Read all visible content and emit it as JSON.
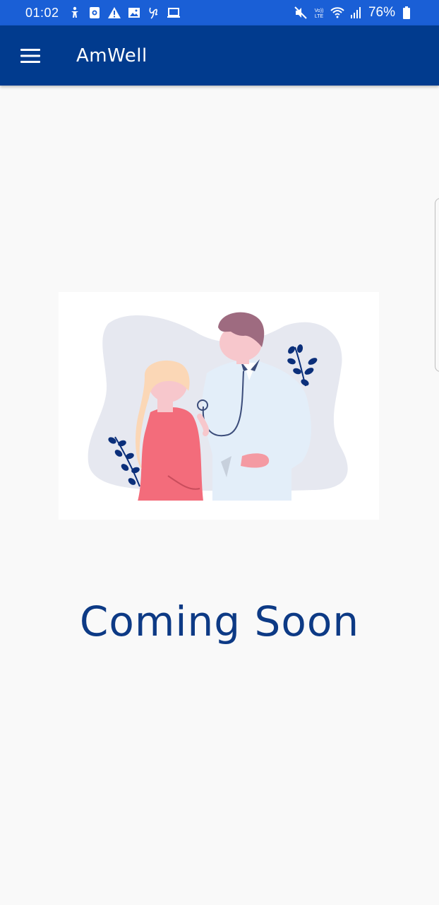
{
  "status_bar": {
    "time": "01:02",
    "battery": "76%",
    "left_icons": [
      "accessibility-icon",
      "screen-record-icon",
      "warning-icon",
      "gallery-icon",
      "signature-icon",
      "laptop-icon"
    ],
    "right_icons": [
      "mute-icon",
      "volte-icon",
      "wifi-icon",
      "signal-icon",
      "battery-icon"
    ]
  },
  "app_bar": {
    "title": "AmWell",
    "menu_icon": "hamburger-menu-icon",
    "background": "#013b8e"
  },
  "main": {
    "illustration": "doctor-patient-illustration",
    "message": "Coming Soon",
    "message_color": "#0d3a85"
  }
}
